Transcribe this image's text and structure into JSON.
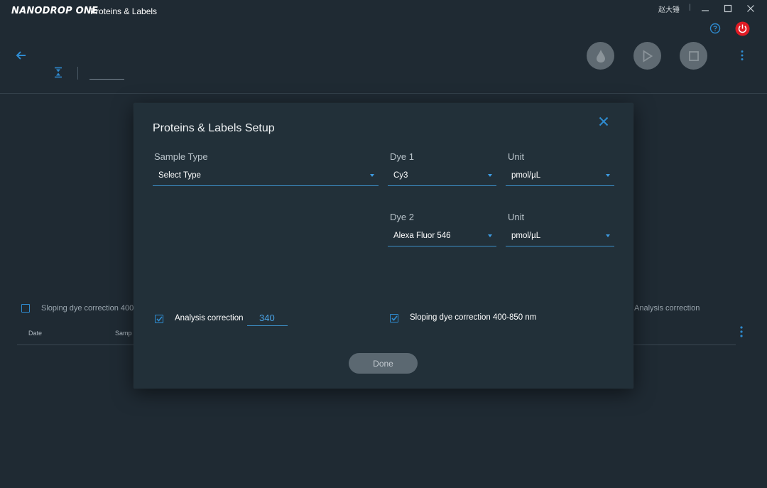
{
  "titlebar": {
    "brand": "NANODROP ONE",
    "app_title": "Proteins & Labels",
    "user_name": "赵大锤",
    "separator": "|"
  },
  "icons": {
    "help": "help-circle-icon",
    "power": "power-icon",
    "back": "arrow-left-icon",
    "sort": "sort-icon",
    "sample": "droplet-icon",
    "measure": "play-icon",
    "end": "stop-icon",
    "more": "more-vertical-icon",
    "close": "close-icon",
    "minimize": "minimize-icon",
    "maximize": "maximize-icon",
    "window_close": "window-close-icon"
  },
  "colors": {
    "accent": "#2e8bd0",
    "power": "#e01b24",
    "background": "#1f2a33",
    "dialog": "#223039"
  },
  "background_view": {
    "sloping_label": "Sloping dye correction 400",
    "analysis_label": "Analysis correction",
    "columns": [
      "Date",
      "Samp"
    ]
  },
  "dialog": {
    "title": "Proteins & Labels Setup",
    "sample_type": {
      "label": "Sample Type",
      "value": "Select Type"
    },
    "dye1": {
      "label": "Dye 1",
      "value": "Cy3"
    },
    "unit1": {
      "label": "Unit",
      "value": "pmol/µL"
    },
    "dye2": {
      "label": "Dye 2",
      "value": "Alexa Fluor 546"
    },
    "unit2": {
      "label": "Unit",
      "value": "pmol/µL"
    },
    "analysis_correction": {
      "label": "Analysis correction",
      "checked": true,
      "value": "340"
    },
    "sloping_correction": {
      "label": "Sloping dye correction 400-850 nm",
      "checked": true
    },
    "done_label": "Done"
  }
}
